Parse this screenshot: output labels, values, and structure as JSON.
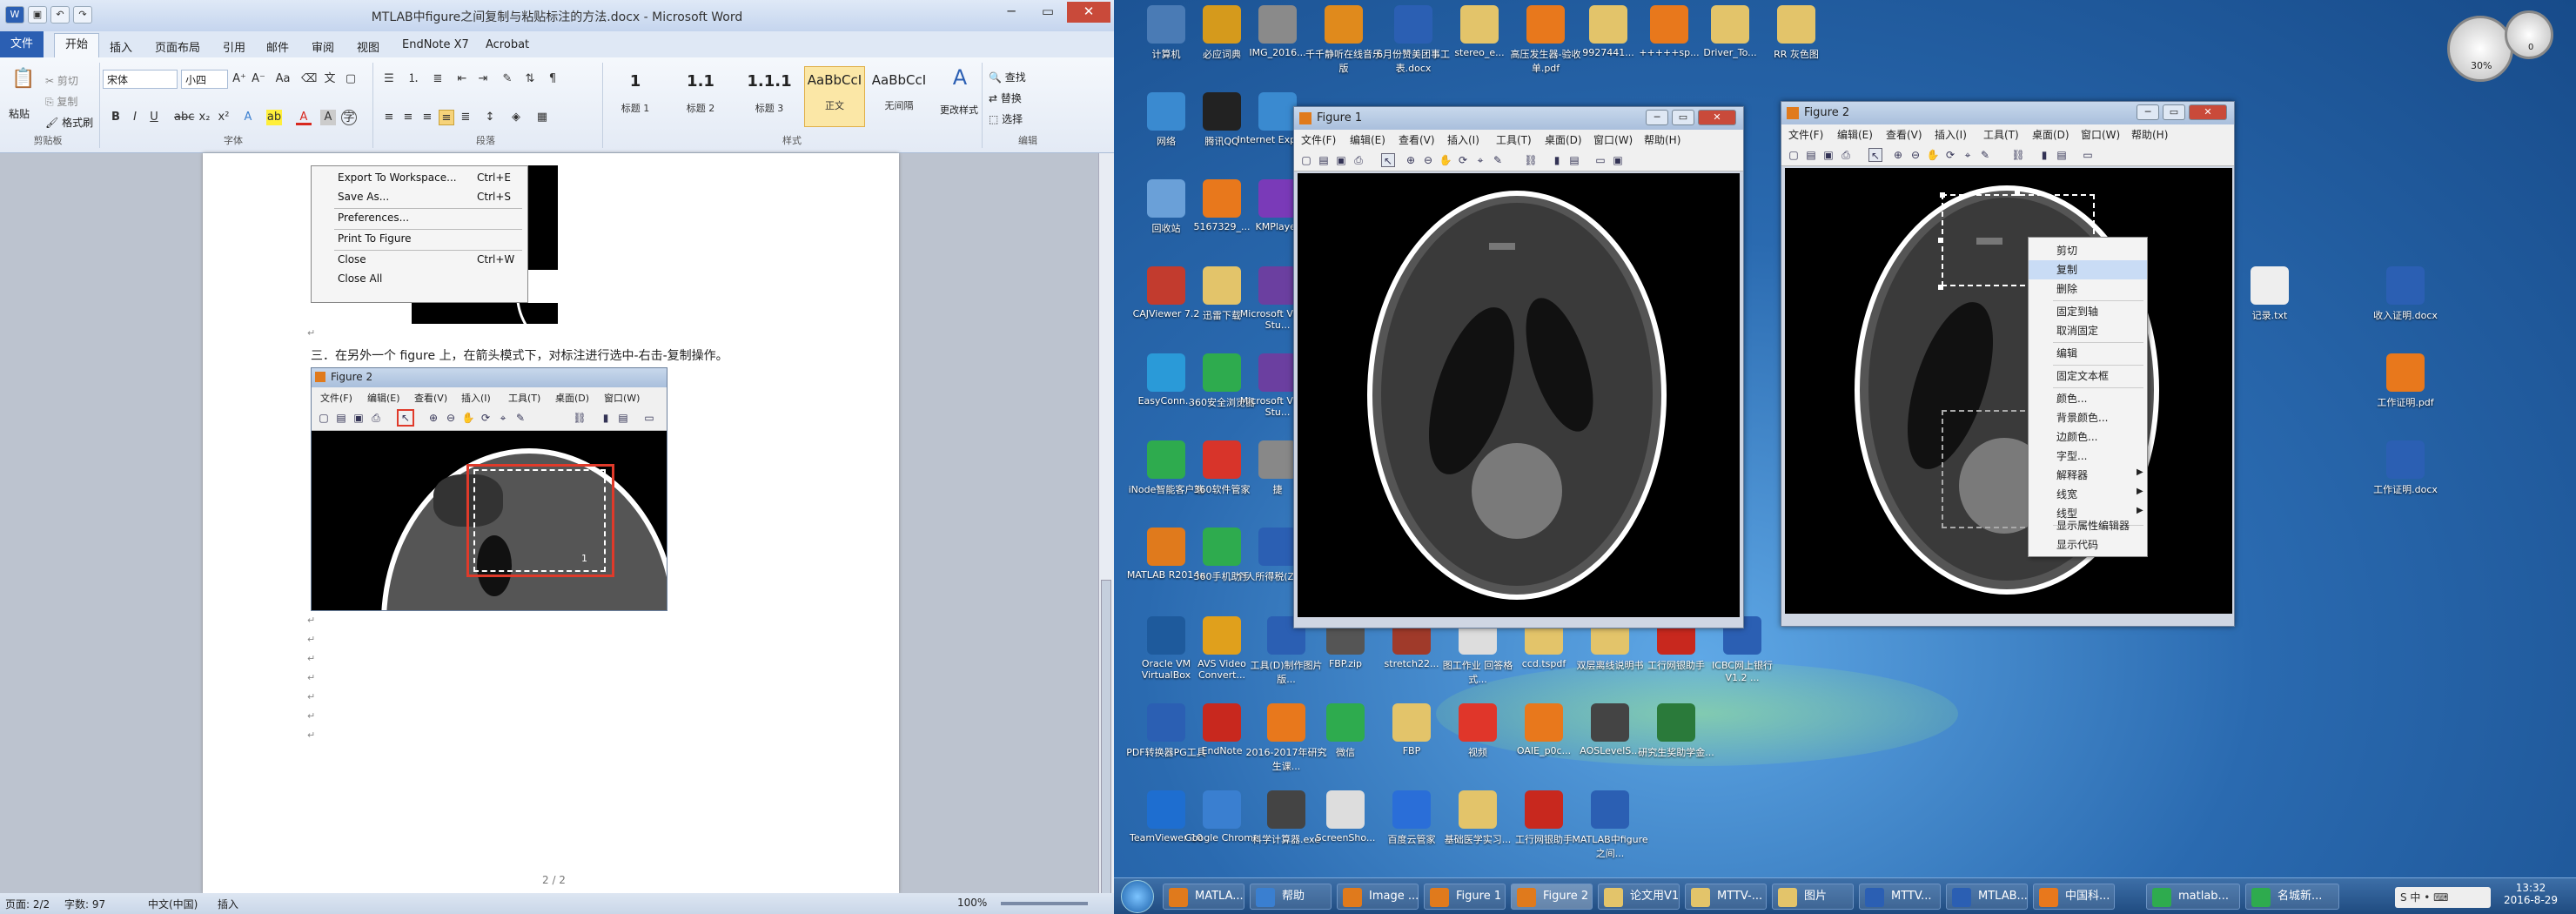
{
  "word": {
    "title": "MTLAB中figure之间复制与粘贴标注的方法.docx - Microsoft Word",
    "tabs": [
      "文件",
      "开始",
      "插入",
      "页面布局",
      "引用",
      "邮件",
      "审阅",
      "视图",
      "EndNote X7",
      "Acrobat"
    ],
    "active_tab": "开始",
    "clipboard": {
      "paste": "粘贴",
      "cut": "剪切",
      "copy": "复制",
      "painter": "格式刷",
      "group": "剪贴板"
    },
    "font": {
      "name": "宋体",
      "size": "小四",
      "group": "字体"
    },
    "paragraph_group": "段落",
    "styles": {
      "items": [
        {
          "preview": "1",
          "name": "标题 1"
        },
        {
          "preview": "1.1",
          "name": "标题 2"
        },
        {
          "preview": "1.1.1",
          "name": "标题 3"
        },
        {
          "preview": "AaBbCcI",
          "name": "正文"
        },
        {
          "preview": "AaBbCcI",
          "name": "无间隔"
        }
      ],
      "change": "更改样式",
      "group": "样式"
    },
    "editing": {
      "find": "查找",
      "replace": "替换",
      "select": "选择",
      "group": "编辑"
    },
    "doc": {
      "menu_items": [
        {
          "label": "Export To Workspace...",
          "key": "Ctrl+E"
        },
        {
          "label": "Save As...",
          "key": "Ctrl+S"
        },
        {
          "label": "Preferences...",
          "key": ""
        },
        {
          "label": "Print To Figure",
          "key": ""
        },
        {
          "label": "Close",
          "key": "Ctrl+W"
        },
        {
          "label": "Close All",
          "key": ""
        }
      ],
      "step_text": "三．在另外一个 figure 上，在箭头模式下，对标注进行选中-右击-复制操作。",
      "embedded_figure": {
        "title": "Figure 2",
        "menu": [
          "文件(F)",
          "编辑(E)",
          "查看(V)",
          "插入(I)",
          "工具(T)",
          "桌面(D)",
          "窗口(W)"
        ],
        "annotation_number": "1"
      },
      "page_number": "2 / 2"
    },
    "status": {
      "page": "页面: 2/2",
      "words": "字数: 97",
      "language": "中文(中国)",
      "mode": "插入",
      "zoom": "100%"
    }
  },
  "figure1": {
    "title": "Figure 1",
    "menu": [
      "文件(F)",
      "编辑(E)",
      "查看(V)",
      "插入(I)",
      "工具(T)",
      "桌面(D)",
      "窗口(W)",
      "帮助(H)"
    ]
  },
  "figure2": {
    "title": "Figure 2",
    "menu": [
      "文件(F)",
      "编辑(E)",
      "查看(V)",
      "插入(I)",
      "工具(T)",
      "桌面(D)",
      "窗口(W)",
      "帮助(H)"
    ]
  },
  "context_menu": {
    "items": [
      "剪切",
      "复制",
      "删除",
      "固定到轴",
      "取消固定",
      "编辑",
      "固定文本框",
      "颜色...",
      "背景颜色...",
      "边颜色...",
      "字型...",
      "解释器",
      "线宽",
      "线型",
      "显示属性编辑器",
      "显示代码"
    ],
    "selected": "复制"
  },
  "desktop_icons": [
    {
      "label": "计算机",
      "icon": "computer-icon",
      "color": "#4a7bb5"
    },
    {
      "label": "必应词典",
      "icon": "dictionary-icon",
      "color": "#d59a1c"
    },
    {
      "label": "IMG_2016...",
      "icon": "file-icon",
      "color": "#8a8a8a"
    },
    {
      "label": "千千静听在线音乐版",
      "icon": "music-icon",
      "color": "#e08a1c"
    },
    {
      "label": "6月份赞美团事工表.docx",
      "icon": "word-icon",
      "color": "#2b5fb3"
    },
    {
      "label": "stereo_e...",
      "icon": "folder-icon",
      "color": "#e3c46a"
    },
    {
      "label": "高压发生器-验收单.pdf",
      "icon": "pdf-icon",
      "color": "#e8781c"
    },
    {
      "label": "9927441...",
      "icon": "folder-icon",
      "color": "#e3c46a"
    },
    {
      "label": "+++++sp...",
      "icon": "pdf-icon",
      "color": "#e8781c"
    },
    {
      "label": "Driver_To...",
      "icon": "folder-icon",
      "color": "#e3c46a"
    },
    {
      "label": "RR 灰色图",
      "icon": "folder-icon",
      "color": "#e3c46a"
    },
    {
      "label": "网络",
      "icon": "network-icon",
      "color": "#3a8ad0"
    },
    {
      "label": "腾讯QQ",
      "icon": "qq-icon",
      "color": "#222"
    },
    {
      "label": "Internet Explorer",
      "icon": "ie-icon",
      "color": "#3a8ad0"
    },
    {
      "label": "回收站",
      "icon": "recycle-bin-icon",
      "color": "#6aa0d8"
    },
    {
      "label": "5167329_...",
      "icon": "pdf-icon",
      "color": "#e8781c"
    },
    {
      "label": "KMPlayer",
      "icon": "player-icon",
      "color": "#7a3ab8"
    },
    {
      "label": "CAJViewer 7.2",
      "icon": "caj-icon",
      "color": "#c23b2e"
    },
    {
      "label": "迅雷下载",
      "icon": "folder-icon",
      "color": "#e3c46a"
    },
    {
      "label": "Microsoft Visual Stu...",
      "icon": "vs-icon",
      "color": "#6b3fa0"
    },
    {
      "label": "EasyConn...",
      "icon": "easyconn-icon",
      "color": "#2a9ad8"
    },
    {
      "label": "360安全浏览器",
      "icon": "browser-360-icon",
      "color": "#2eab4e"
    },
    {
      "label": "Microsoft Visual Stu...",
      "icon": "vs-icon",
      "color": "#6b3fa0"
    },
    {
      "label": "iNode智能客户端",
      "icon": "inode-icon",
      "color": "#2eab4e"
    },
    {
      "label": "360软件管家",
      "icon": "software-manager-icon",
      "color": "#d8342a"
    },
    {
      "label": "捷",
      "icon": "app-icon",
      "color": "#888"
    },
    {
      "label": "MATLAB R2014a",
      "icon": "matlab-icon",
      "color": "#e07a1c"
    },
    {
      "label": "360手机助手",
      "icon": "phone-assistant-icon",
      "color": "#2eab4e"
    },
    {
      "label": "个人所得税(ZjWLt)",
      "icon": "word-icon",
      "color": "#2b5fb3"
    },
    {
      "label": "Oracle VM VirtualBox",
      "icon": "virtualbox-icon",
      "color": "#1e5a9c"
    },
    {
      "label": "AVS Video Convert...",
      "icon": "avs-icon",
      "color": "#e0a01c"
    },
    {
      "label": "工具(D)制作图片版...",
      "icon": "tool-icon",
      "color": "#2b5fb3"
    },
    {
      "label": "FBP.zip",
      "icon": "zip-icon",
      "color": "#555"
    },
    {
      "label": "stretch22...",
      "icon": "image-icon",
      "color": "#a03a2a"
    },
    {
      "label": "图工作业 回答格式...",
      "icon": "doc-icon",
      "color": "#ddd"
    },
    {
      "label": "ccd.tspdf",
      "icon": "folder-icon",
      "color": "#e3c46a"
    },
    {
      "label": "双层离线说明书",
      "icon": "folder-icon",
      "color": "#e3c46a"
    },
    {
      "label": "工行网银助手",
      "icon": "bank-icon",
      "color": "#c8281e"
    },
    {
      "label": "ICBC网上银行 V1.2 ...",
      "icon": "word-icon",
      "color": "#2b5fb3"
    },
    {
      "label": "PDF转换器PG工具",
      "icon": "pdf-convert-icon",
      "color": "#2b5fb3"
    },
    {
      "label": "EndNote",
      "icon": "endnote-icon",
      "color": "#c8281e"
    },
    {
      "label": "2016-2017年研究生课...",
      "icon": "pdf-icon",
      "color": "#e8781c"
    },
    {
      "label": "微信",
      "icon": "wechat-icon",
      "color": "#2eab4e"
    },
    {
      "label": "FBP",
      "icon": "folder-icon",
      "color": "#e3c46a"
    },
    {
      "label": "视频",
      "icon": "video-icon",
      "color": "#e0362a"
    },
    {
      "label": "OAIE_p0c...",
      "icon": "pdf-icon",
      "color": "#e8781c"
    },
    {
      "label": "AOSLevelS...",
      "icon": "tool-icon",
      "color": "#444"
    },
    {
      "label": "研究生奖助学金...",
      "icon": "excel-icon",
      "color": "#2a7a3a"
    },
    {
      "label": "TeamViewer 10",
      "icon": "teamviewer-icon",
      "color": "#1e6ed0"
    },
    {
      "label": "Google Chrome",
      "icon": "chrome-icon",
      "color": "#3a7fd0"
    },
    {
      "label": "科学计算器.exe",
      "icon": "calculator-icon",
      "color": "#444"
    },
    {
      "label": "ScreenSho...",
      "icon": "doc-icon",
      "color": "#ddd"
    },
    {
      "label": "百度云管家",
      "icon": "baidu-icon",
      "color": "#2a6ed8"
    },
    {
      "label": "基础医学实习...",
      "icon": "folder-icon",
      "color": "#e3c46a"
    },
    {
      "label": "工行网银助手",
      "icon": "bank-icon",
      "color": "#c8281e"
    },
    {
      "label": "MATLAB中figure之间...",
      "icon": "word-icon",
      "color": "#2b5fb3"
    },
    {
      "label": "记录.txt",
      "icon": "text-icon",
      "color": "#eee"
    },
    {
      "label": "收入证明.docx",
      "icon": "word-icon",
      "color": "#2b5fb3"
    },
    {
      "label": "工作证明.pdf",
      "icon": "pdf-icon",
      "color": "#e8781c"
    },
    {
      "label": "工作证明.docx",
      "icon": "word-icon",
      "color": "#2b5fb3"
    }
  ],
  "taskbar": {
    "items": [
      {
        "label": "MATLA...",
        "icon": "matlab-icon",
        "color": "#e07a1c"
      },
      {
        "label": "帮助",
        "icon": "help-icon",
        "color": "#3a7fd0"
      },
      {
        "label": "Image ...",
        "icon": "matlab-icon",
        "color": "#e07a1c"
      },
      {
        "label": "Figure 1",
        "icon": "matlab-icon",
        "color": "#e07a1c"
      },
      {
        "label": "Figure 2",
        "icon": "matlab-icon",
        "color": "#e07a1c"
      },
      {
        "label": "论文用V1",
        "icon": "folder-icon",
        "color": "#e3c46a"
      },
      {
        "label": "MTTV-...",
        "icon": "folder-icon",
        "color": "#e3c46a"
      },
      {
        "label": "图片",
        "icon": "folder-icon",
        "color": "#e3c46a"
      },
      {
        "label": "MTTV...",
        "icon": "word-icon",
        "color": "#2b5fb3"
      },
      {
        "label": "MTLAB...",
        "icon": "word-icon",
        "color": "#2b5fb3"
      },
      {
        "label": "中国科...",
        "icon": "pdf-icon",
        "color": "#e8781c"
      },
      {
        "label": "matlab...",
        "icon": "chrome-icon",
        "color": "#2eab4e"
      },
      {
        "label": "名城新...",
        "icon": "chrome-icon",
        "color": "#2eab4e"
      }
    ],
    "time": "13:32",
    "date": "2016-8-29"
  },
  "gauge": {
    "left_value": "30%",
    "right_value": "0"
  }
}
